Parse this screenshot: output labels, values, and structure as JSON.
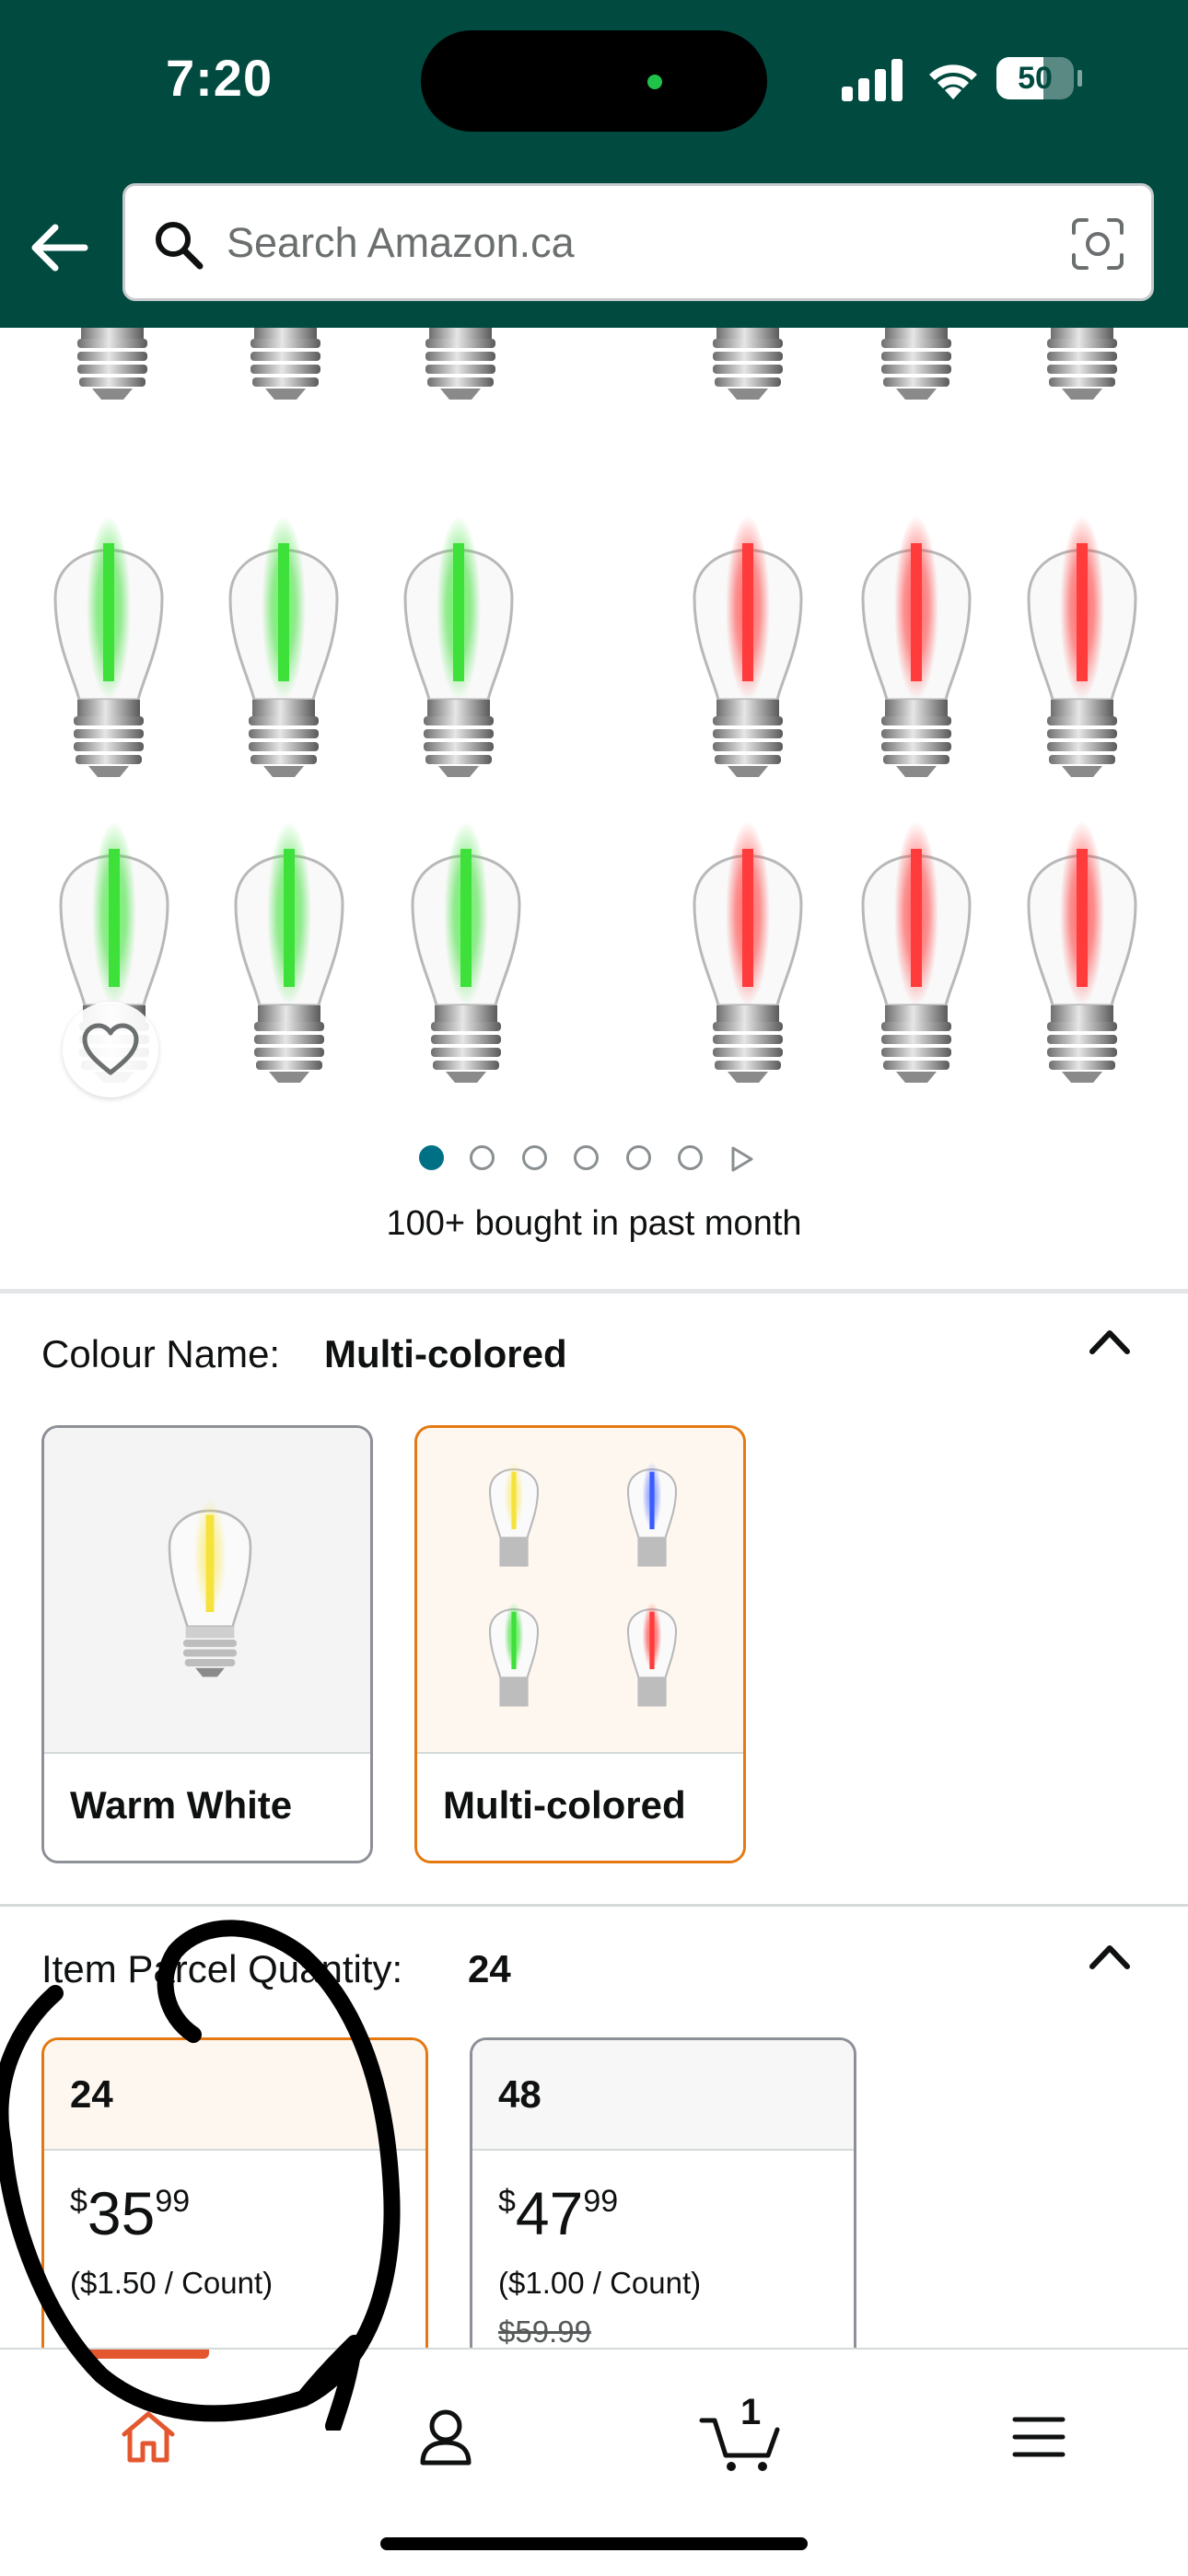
{
  "status_bar": {
    "time": "7:20",
    "battery": "50"
  },
  "search": {
    "placeholder": "Search Amazon.ca"
  },
  "gallery": {
    "bought_text": "100+ bought in past month",
    "page_count": 6,
    "active_page": 1
  },
  "colour": {
    "label": "Colour Name:",
    "selected": "Multi-colored",
    "options": [
      {
        "label": "Warm White",
        "selected": false
      },
      {
        "label": "Multi-colored",
        "selected": true
      }
    ]
  },
  "quantity": {
    "label": "Item Parcel Quantity:",
    "selected": "24",
    "options": [
      {
        "qty": "24",
        "currency": "$",
        "whole": "35",
        "fraction": "99",
        "unit_price": "($1.50 / Count)",
        "list_price": "",
        "selected": true
      },
      {
        "qty": "48",
        "currency": "$",
        "whole": "47",
        "fraction": "99",
        "unit_price": "($1.00 / Count)",
        "list_price": "$59.99",
        "selected": false
      }
    ]
  },
  "bottom_nav": {
    "cart_count": "1"
  },
  "colors": {
    "header_bg": "#004a3f",
    "accent_orange": "#e47911",
    "link_teal": "#007185",
    "bulb_green": "#3ee03a",
    "bulb_red": "#ff3b3b",
    "bulb_yellow": "#f6e23c",
    "bulb_blue": "#3b5bff"
  }
}
